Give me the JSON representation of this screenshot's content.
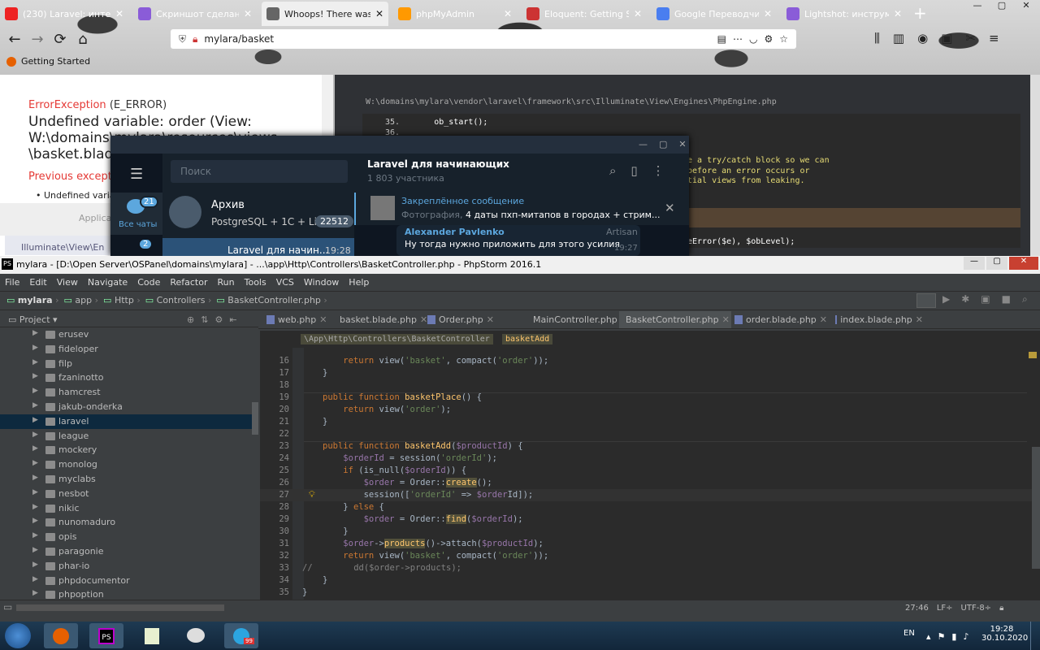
{
  "browser": {
    "tabs": [
      {
        "label": "(230) Laravel: интерне",
        "color": "#e22"
      },
      {
        "label": "Скриншот сделан с п",
        "color": "#8a5cd8"
      },
      {
        "label": "Whoops! There was an err",
        "color": "#666"
      },
      {
        "label": "phpMyAdmin",
        "color": "#f90"
      },
      {
        "label": "Eloquent: Getting Star",
        "color": "#c33"
      },
      {
        "label": "Google Переводчик",
        "color": "#4a7ef0"
      },
      {
        "label": "Lightshot: инструмен",
        "color": "#8a5cd8"
      }
    ],
    "url": "mylara/basket",
    "bookmark": "Getting Started",
    "error": {
      "type": "ErrorException",
      "level": "(E_ERROR)",
      "message_l1": "Undefined variable: order (View:",
      "message_l2": "W:\\domains\\mylara\\resources\\views",
      "message_l3": "\\basket.blade",
      "prev": "Previous exception",
      "bullet": "Undefined variab",
      "app": "Applica",
      "frame": "Illuminate\\View\\En"
    },
    "debug": {
      "path": "W:\\domains\\mylara\\vendor\\laravel\\framework\\src\\Illuminate\\View\\Engines\\PhpEngine.php",
      "lines": [
        {
          "n": "35.",
          "t": "ob_start();"
        },
        {
          "n": "36.",
          "t": ""
        }
      ],
      "comment1": "e a try/catch block so we can",
      "comment2": " before an error occurs or",
      "comment3": "tial views from leaking.",
      "call": "eError($e), $obLevel);"
    }
  },
  "telegram": {
    "search": "Поиск",
    "all_chats": "Все чаты",
    "badge1": "21",
    "badge2": "2",
    "archive_title": "Архив",
    "archive_sub": "PostgreSQL + 1C + Li...",
    "archive_count": "22512",
    "chat2_title": "Laravel для начин...",
    "chat2_time": "19:28",
    "group_title": "Laravel для начинающих",
    "group_sub": "1 803 участника",
    "pinned_title": "Закреплённое сообщение",
    "pinned_prefix": "Фотография,",
    "pinned_text": " 4 даты пхп-митапов в городах + стрим...",
    "msg_author": "Alexander Pavlenko",
    "msg_tag": "Artisan",
    "msg_text": "Ну тогда нужно приложить для этого усилия",
    "msg_time": "19:27"
  },
  "phpstorm": {
    "title": "mylara - [D:\\Open Server\\OSPanel\\domains\\mylara] - ...\\app\\Http\\Controllers\\BasketController.php - PhpStorm 2016.1",
    "menu": [
      "File",
      "Edit",
      "View",
      "Navigate",
      "Code",
      "Refactor",
      "Run",
      "Tools",
      "VCS",
      "Window",
      "Help"
    ],
    "breadcrumb": [
      "mylara",
      "app",
      "Http",
      "Controllers",
      "BasketController.php"
    ],
    "project_label": "Project",
    "tabs": [
      "web.php",
      "basket.blade.php",
      "Order.php",
      "MainController.php",
      "BasketController.php",
      "order.blade.php",
      "index.blade.php"
    ],
    "active_tab": 4,
    "crumb_path": "\\App\\Http\\Controllers\\BasketController",
    "crumb_method": "basketAdd",
    "tree": [
      "erusev",
      "fideloper",
      "filp",
      "fzaninotto",
      "hamcrest",
      "jakub-onderka",
      "laravel",
      "league",
      "mockery",
      "monolog",
      "myclabs",
      "nesbot",
      "nikic",
      "nunomaduro",
      "opis",
      "paragonie",
      "phar-io",
      "phpdocumentor",
      "phpoption"
    ],
    "selected_tree": 6,
    "status": {
      "pos": "27:46",
      "le": "LF÷",
      "enc": "UTF-8÷"
    }
  },
  "taskbar": {
    "lang": "EN",
    "time": "19:28",
    "date": "30.10.2020",
    "tg_badge": "99"
  }
}
